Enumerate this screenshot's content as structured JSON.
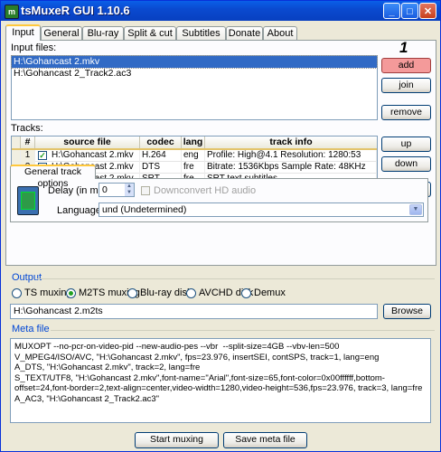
{
  "window": {
    "title": "tsMuxeR GUI 1.10.6",
    "app_icon_glyph": "m",
    "buttons": [
      "_",
      "□",
      "✕"
    ]
  },
  "tabs": [
    "Input",
    "General",
    "Blu-ray",
    "Split & cut",
    "Subtitles",
    "Donate",
    "About"
  ],
  "input": {
    "files_label": "Input files:",
    "files": [
      "H:\\Gohancast 2.mkv",
      "H:\\Gohancast 2_Track2.ac3"
    ],
    "badge": "1",
    "add_label": "add",
    "join_label": "join",
    "remove_label": "remove"
  },
  "tracks": {
    "label": "Tracks:",
    "columns": [
      "#",
      "source file",
      "codec",
      "lang",
      "track info"
    ],
    "rows": [
      {
        "num": "1",
        "checked": true,
        "source": "H:\\Gohancast 2.mkv",
        "codec": "H.264",
        "lang": "eng",
        "info": "Profile: High@4.1  Resolution: 1280:53"
      },
      {
        "num": "2",
        "checked": true,
        "source": "H:\\Gohancast 2.mkv",
        "codec": "DTS",
        "lang": "fre",
        "info": "Bitrate: 1536Kbps  Sample Rate: 48KHz"
      },
      {
        "num": "3",
        "checked": true,
        "source": "H:\\Gohancast 2.mkv",
        "codec": "SRT",
        "lang": "fre",
        "info": "SRT text subtitles"
      },
      {
        "num": "4",
        "checked": true,
        "source": "H:\\Gohancast 2_Track2.ac3",
        "codec": "AC3",
        "lang": "",
        "info": "Bitrate: 640Kbps Sample Rate: 48KHz C"
      }
    ],
    "up_label": "up",
    "down_label": "down",
    "remove_label": "remove"
  },
  "track_options": {
    "tab_label": "General track options",
    "delay_label": "Delay (in ms):",
    "delay_value": "0",
    "downconvert_label": "Downconvert HD audio",
    "language_label": "Language:",
    "language_value": "und (Undetermined)"
  },
  "output": {
    "title": "Output",
    "modes": [
      "TS muxing",
      "M2TS muxing",
      "Blu-ray disk",
      "AVCHD disk",
      "Demux"
    ],
    "selected_mode": "M2TS muxing",
    "path": "H:\\Gohancast 2.m2ts",
    "browse_label": "Browse"
  },
  "meta": {
    "title": "Meta file",
    "content": "MUXOPT --no-pcr-on-video-pid --new-audio-pes --vbr  --split-size=4GB --vbv-len=500\nV_MPEG4/ISO/AVC, \"H:\\Gohancast 2.mkv\", fps=23.976, insertSEI, contSPS, track=1, lang=eng\nA_DTS, \"H:\\Gohancast 2.mkv\", track=2, lang=fre\nS_TEXT/UTF8, \"H:\\Gohancast 2.mkv\",font-name=\"Arial\",font-size=65,font-color=0x00ffffff,bottom-offset=24,font-border=2,text-align=center,video-width=1280,video-height=536,fps=23.976, track=3, lang=fre\nA_AC3, \"H:\\Gohancast 2_Track2.ac3\""
  },
  "footer": {
    "start_label": "Start muxing",
    "save_label": "Save meta file"
  },
  "colors": {
    "title_bar": "#0a4ad0",
    "add_button": "#f49a9a",
    "selection": "#316ac5",
    "check": "#21a121",
    "group_title": "#0046d5"
  }
}
